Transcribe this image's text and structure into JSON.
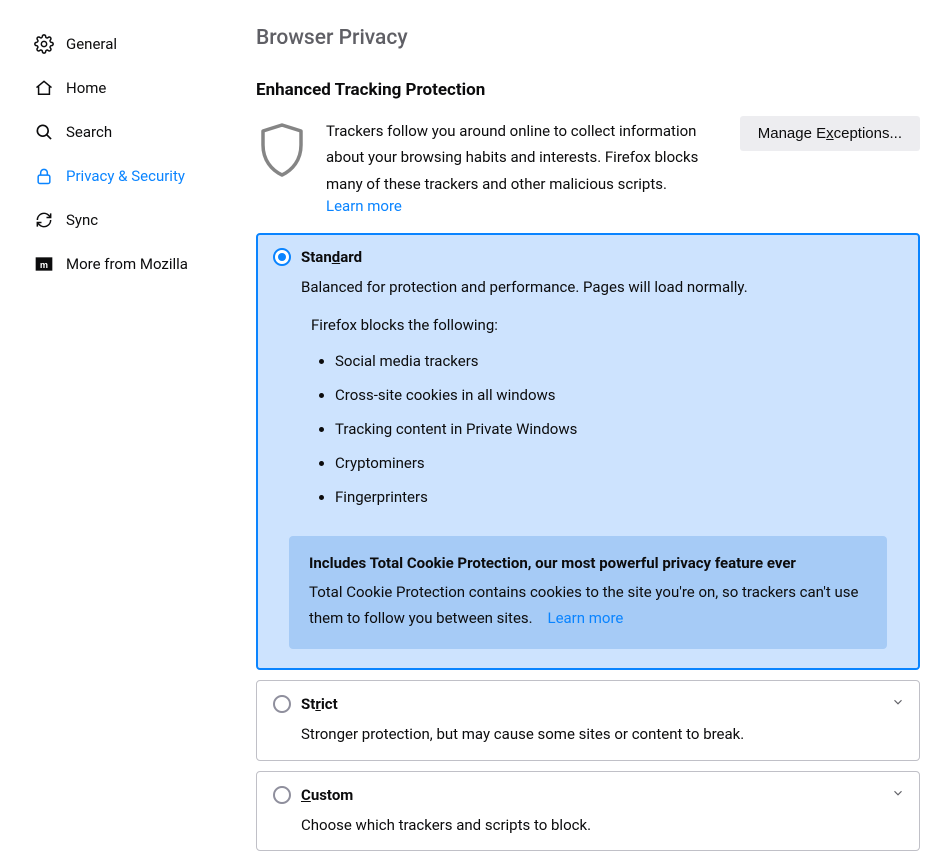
{
  "sidebar": {
    "items": [
      {
        "label": "General"
      },
      {
        "label": "Home"
      },
      {
        "label": "Search"
      },
      {
        "label": "Privacy & Security"
      },
      {
        "label": "Sync"
      },
      {
        "label": "More from Mozilla"
      }
    ]
  },
  "page": {
    "title": "Browser Privacy",
    "section_title": "Enhanced Tracking Protection",
    "etp_desc": "Trackers follow you around online to collect information about your browsing habits and interests. Firefox blocks many of these trackers and other malicious scripts.",
    "learn_more": "Learn more",
    "buttons": {
      "manage_exceptions_pre": "Manage E",
      "manage_exceptions_u": "x",
      "manage_exceptions_post": "ceptions..."
    }
  },
  "options": {
    "standard": {
      "title_pre": "Stan",
      "title_u": "d",
      "title_post": "ard",
      "subtitle": "Balanced for protection and performance. Pages will load normally.",
      "blocks_heading": "Firefox blocks the following:",
      "blocks": [
        "Social media trackers",
        "Cross-site cookies in all windows",
        "Tracking content in Private Windows",
        "Cryptominers",
        "Fingerprinters"
      ],
      "banner": {
        "title": "Includes Total Cookie Protection, our most powerful privacy feature ever",
        "body": "Total Cookie Protection contains cookies to the site you're on, so trackers can't use them to follow you between sites.",
        "link": "Learn more"
      }
    },
    "strict": {
      "title_pre": "St",
      "title_u": "r",
      "title_post": "ict",
      "subtitle": "Stronger protection, but may cause some sites or content to break."
    },
    "custom": {
      "title_pre": "",
      "title_u": "C",
      "title_post": "ustom",
      "subtitle": "Choose which trackers and scripts to block."
    }
  }
}
